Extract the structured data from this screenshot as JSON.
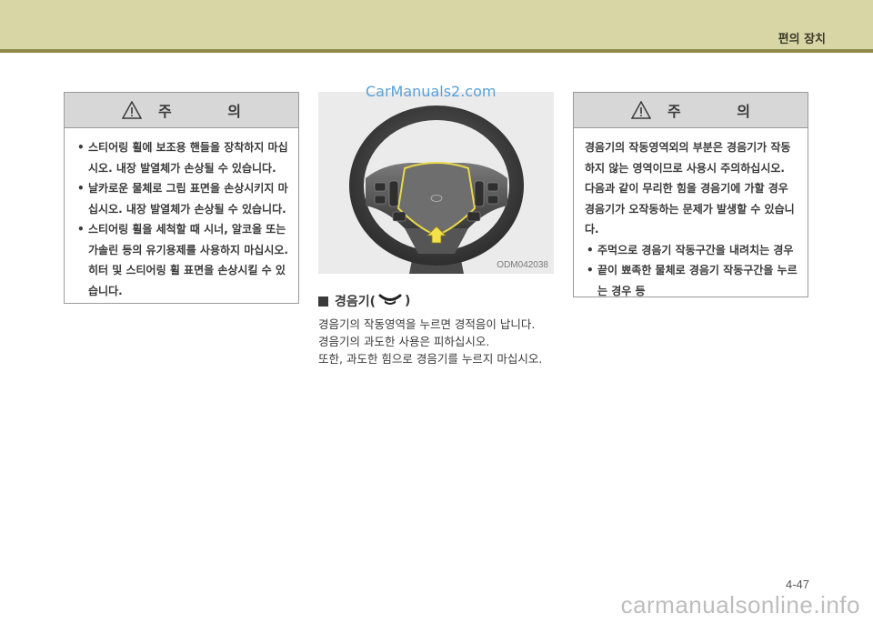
{
  "header": {
    "section_title": "편의 장치",
    "band_color": "#d9d6a6",
    "rule_color": "#8f8a4a"
  },
  "caution_left": {
    "title": "주 의",
    "icon": "warning-triangle-icon",
    "items": [
      "스티어링 휠에 보조용 핸들을 장착하지 마십시오. 내장 발열체가 손상될 수 있습니다.",
      "날카로운 물체로 그립 표면을 손상시키지 마십시오. 내장 발열체가 손상될 수 있습니다.",
      "스티어링 휠을 세척할 때 시너, 알코올 또는 가솔린 등의 유기용제를 사용하지 마십시오. 히터 및 스티어링 휠 표면을 손상시킬 수 있습니다."
    ]
  },
  "figure": {
    "watermark": "CarManuals2.com",
    "code": "ODM042038",
    "icon": "steering-wheel-illustration",
    "highlight_color": "#e8d84a"
  },
  "horn": {
    "heading_prefix": "경음기(",
    "heading_suffix": ")",
    "heading_icon": "horn-icon",
    "paragraphs": [
      "경음기의 작동영역을 누르면 경적음이 납니다.",
      "경음기의 과도한 사용은 피하십시오.",
      "또한, 과도한 힘으로 경음기를 누르지 마십시오."
    ]
  },
  "caution_right": {
    "title": "주 의",
    "icon": "warning-triangle-icon",
    "intro": "경음기의 작동영역외의 부분은 경음기가 작동하지 않는 영역이므로 사용시 주의하십시오. 다음과 같이 무리한 힘을 경음기에 가할 경우 경음기가 오작동하는 문제가 발생할 수 있습니다.",
    "items": [
      "주먹으로 경음기 작동구간을 내려치는 경우",
      "끝이 뾰족한 물체로 경음기 작동구간을 누르는 경우 등"
    ]
  },
  "footer": {
    "page_number": "4-47",
    "watermark": "carmanualsonline.info"
  }
}
